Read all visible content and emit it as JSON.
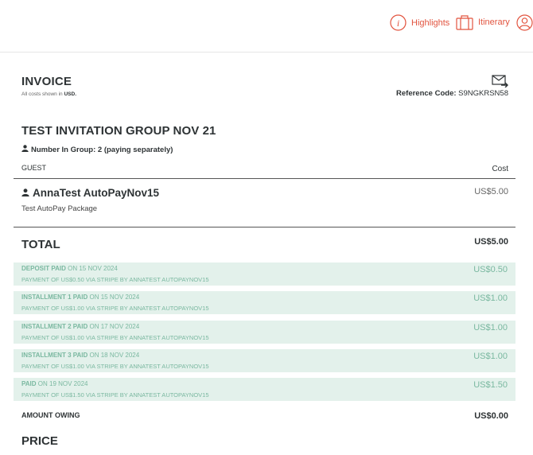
{
  "nav": {
    "highlights_label": "Highlights",
    "itinerary_label": "Itinerary",
    "accent_color": "#e2543f"
  },
  "invoice": {
    "title": "INVOICE",
    "costs_note_prefix": "All costs shown in",
    "currency": "USD.",
    "reference_label": "Reference Code:",
    "reference_code": "S9NGKRSN58"
  },
  "group": {
    "title": "TEST INVITATION GROUP NOV 21",
    "count_text": "Number In Group: 2 (paying separately)"
  },
  "table": {
    "guest_header": "GUEST",
    "cost_header": "Cost",
    "guest": {
      "name": "AnnaTest AutoPayNov15",
      "package": "Test AutoPay Package",
      "cost": "US$5.00"
    }
  },
  "total": {
    "label": "TOTAL",
    "value": "US$5.00"
  },
  "payments": [
    {
      "status": "DEPOSIT PAID",
      "date": "ON 15 NOV 2024",
      "desc": "PAYMENT OF US$0.50 VIA STRIPE BY ANNATEST AUTOPAYNOV15",
      "amount": "US$0.50"
    },
    {
      "status": "INSTALLMENT 1 PAID",
      "date": "ON 15 NOV 2024",
      "desc": "PAYMENT OF US$1.00 VIA STRIPE BY ANNATEST AUTOPAYNOV15",
      "amount": "US$1.00"
    },
    {
      "status": "INSTALLMENT 2 PAID",
      "date": "ON 17 NOV 2024",
      "desc": "PAYMENT OF US$1.00 VIA STRIPE BY ANNATEST AUTOPAYNOV15",
      "amount": "US$1.00"
    },
    {
      "status": "INSTALLMENT 3 PAID",
      "date": "ON 18 NOV 2024",
      "desc": "PAYMENT OF US$1.00 VIA STRIPE BY ANNATEST AUTOPAYNOV15",
      "amount": "US$1.00"
    },
    {
      "status": "PAID",
      "date": "ON 19 NOV 2024",
      "desc": "PAYMENT OF US$1.50 VIA STRIPE BY ANNATEST AUTOPAYNOV15",
      "amount": "US$1.50"
    }
  ],
  "owing": {
    "label": "AMOUNT OWING",
    "value": "US$0.00"
  },
  "price": {
    "title": "PRICE"
  },
  "icons": {
    "highlights": "info-circle-icon",
    "itinerary": "suitcase-icon",
    "account": "user-settings-icon",
    "email": "envelope-forward-icon",
    "person": "person-icon"
  },
  "colors": {
    "paid_row_bg": "#e3f1eb",
    "paid_text": "#7ab8a0"
  }
}
